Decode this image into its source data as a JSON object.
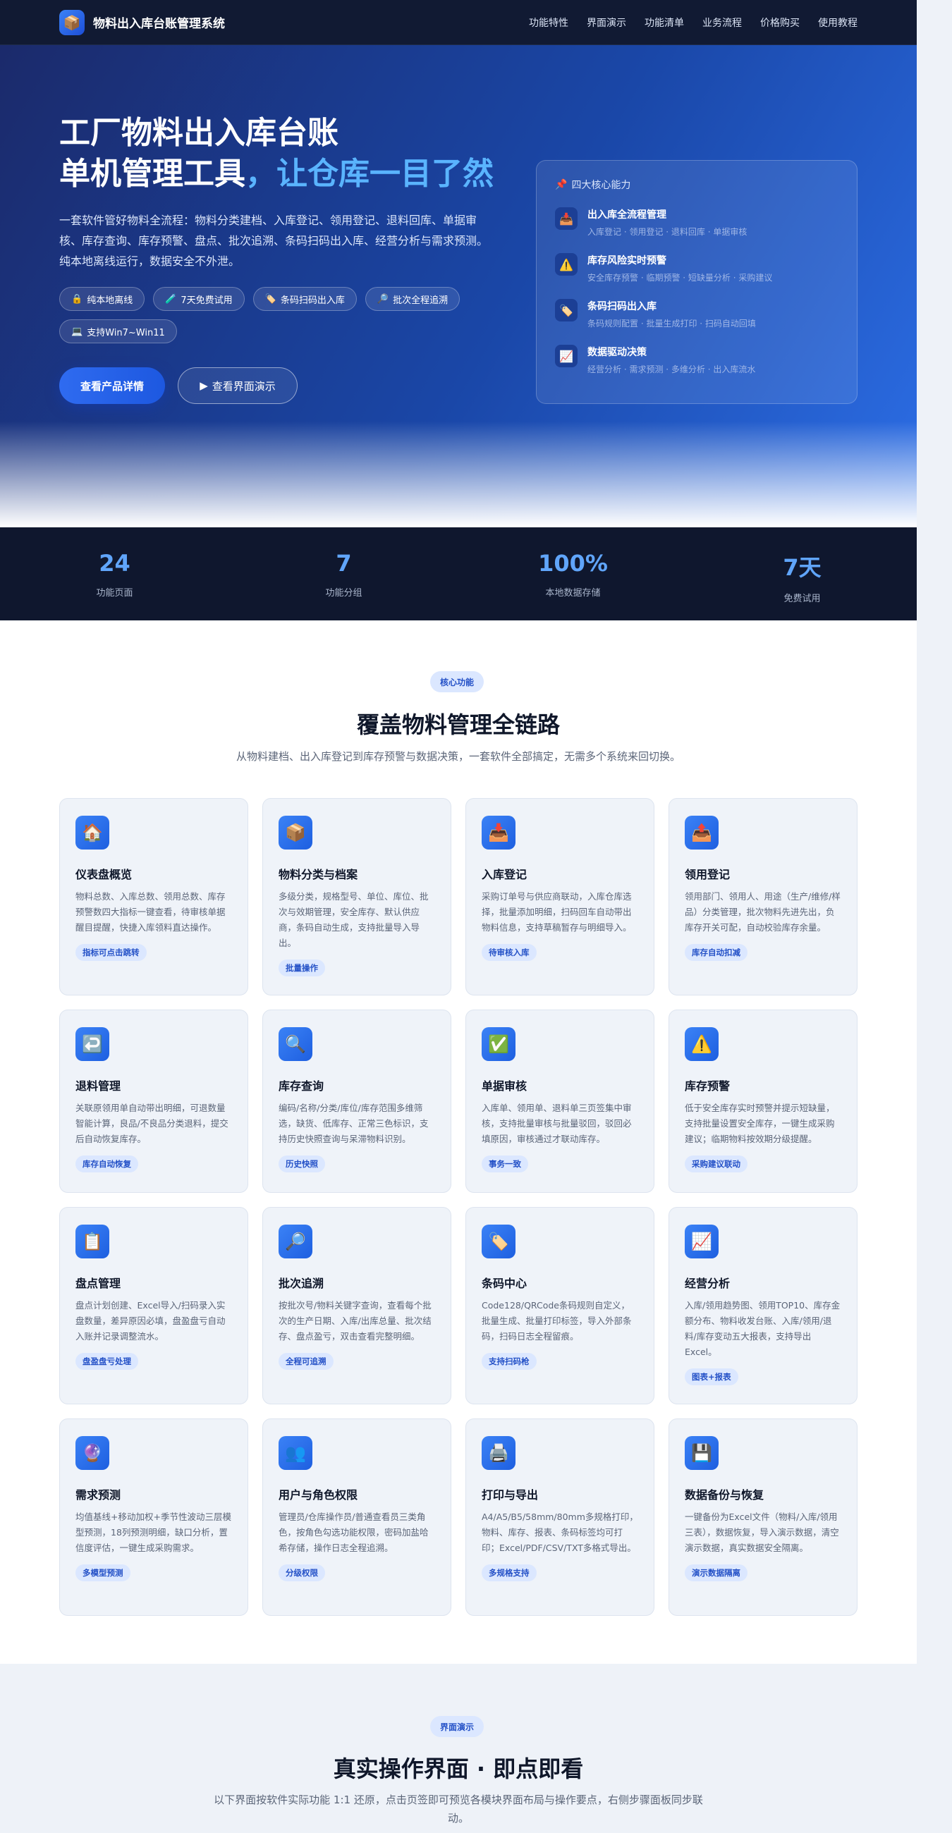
{
  "nav": {
    "brand_icon": "box-icon",
    "brand": "物料出入库台账管理系统",
    "links": [
      "功能特性",
      "界面演示",
      "功能清单",
      "业务流程",
      "价格购买",
      "使用教程"
    ]
  },
  "hero": {
    "title_line1": "工厂物料出入库台账",
    "title_line2": "单机管理工具",
    "title_accent": "，让仓库一目了然",
    "description": "一套软件管好物料全流程：物料分类建档、入库登记、领用登记、退料回库、单据审核、库存查询、库存预警、盘点、批次追溯、条码扫码出入库、经营分析与需求预测。纯本地离线运行，数据安全不外泄。",
    "chips": [
      {
        "icon": "🔒",
        "label": "纯本地离线"
      },
      {
        "icon": "🧪",
        "label": "7天免费试用"
      },
      {
        "icon": "🏷️",
        "label": "条码扫码出入库"
      },
      {
        "icon": "🔎",
        "label": "批次全程追溯"
      },
      {
        "icon": "💻",
        "label": "支持Win7~Win11"
      }
    ],
    "primary_button": "查看产品详情",
    "secondary_button": "查看界面演示"
  },
  "capabilities": {
    "header": "四大核心能力",
    "items": [
      {
        "icon": "📥",
        "title": "出入库全流程管理",
        "sub": "入库登记 · 领用登记 · 退料回库 · 单据审核"
      },
      {
        "icon": "⚠️",
        "title": "库存风险实时预警",
        "sub": "安全库存预警 · 临期预警 · 短缺量分析 · 采购建议"
      },
      {
        "icon": "🏷️",
        "title": "条码扫码出入库",
        "sub": "条码规则配置 · 批量生成打印 · 扫码自动回填"
      },
      {
        "icon": "📈",
        "title": "数据驱动决策",
        "sub": "经营分析 · 需求预测 · 多维分析 · 出入库流水"
      }
    ]
  },
  "stats": [
    {
      "value": "24",
      "label": "功能页面"
    },
    {
      "value": "7",
      "label": "功能分组"
    },
    {
      "value": "100%",
      "label": "本地数据存储"
    },
    {
      "value": "7天",
      "label": "免费试用"
    }
  ],
  "features": {
    "tag": "核心功能",
    "title": "覆盖物料管理全链路",
    "subtitle": "从物料建档、出入库登记到库存预警与数据决策，一套软件全部搞定，无需多个系统来回切换。",
    "cards": [
      {
        "icon": "🏠",
        "title": "仪表盘概览",
        "desc": "物料总数、入库总数、领用总数、库存预警数四大指标一键查看，待审核单据醒目提醒，快捷入库领料直达操作。",
        "tag": "指标可点击跳转"
      },
      {
        "icon": "📦",
        "title": "物料分类与档案",
        "desc": "多级分类，规格型号、单位、库位、批次与效期管理，安全库存、默认供应商，条码自动生成，支持批量导入导出。",
        "tag": "批量操作"
      },
      {
        "icon": "📥",
        "title": "入库登记",
        "desc": "采购订单号与供应商联动，入库仓库选择，批量添加明细，扫码回车自动带出物料信息，支持草稿暂存与明细导入。",
        "tag": "待审核入库"
      },
      {
        "icon": "📤",
        "title": "领用登记",
        "desc": "领用部门、领用人、用途（生产/维修/样品）分类管理，批次物料先进先出，负库存开关可配，自动校验库存余量。",
        "tag": "库存自动扣减"
      },
      {
        "icon": "↩️",
        "title": "退料管理",
        "desc": "关联原领用单自动带出明细，可退数量智能计算，良品/不良品分类退料，提交后自动恢复库存。",
        "tag": "库存自动恢复"
      },
      {
        "icon": "🔍",
        "title": "库存查询",
        "desc": "编码/名称/分类/库位/库存范围多维筛选，缺货、低库存、正常三色标识，支持历史快照查询与呆滞物料识别。",
        "tag": "历史快照"
      },
      {
        "icon": "✅",
        "title": "单据审核",
        "desc": "入库单、领用单、退料单三页签集中审核，支持批量审核与批量驳回，驳回必填原因，审核通过才联动库存。",
        "tag": "事务一致"
      },
      {
        "icon": "⚠️",
        "title": "库存预警",
        "desc": "低于安全库存实时预警并提示短缺量，支持批量设置安全库存，一键生成采购建议；临期物料按效期分级提醒。",
        "tag": "采购建议联动"
      },
      {
        "icon": "📋",
        "title": "盘点管理",
        "desc": "盘点计划创建、Excel导入/扫码录入实盘数量，差异原因必填，盘盈盘亏自动入账并记录调整流水。",
        "tag": "盘盈盘亏处理"
      },
      {
        "icon": "🔎",
        "title": "批次追溯",
        "desc": "按批次号/物料关键字查询，查看每个批次的生产日期、入库/出库总量、批次结存、盘点盈亏，双击查看完整明细。",
        "tag": "全程可追溯"
      },
      {
        "icon": "🏷️",
        "title": "条码中心",
        "desc": "Code128/QRCode条码规则自定义，批量生成、批量打印标签，导入外部条码，扫码日志全程留痕。",
        "tag": "支持扫码枪"
      },
      {
        "icon": "📈",
        "title": "经营分析",
        "desc": "入库/领用趋势图、领用TOP10、库存金额分布、物料收发台账、入库/领用/退料/库存变动五大报表，支持导出Excel。",
        "tag": "图表+报表"
      },
      {
        "icon": "🔮",
        "title": "需求预测",
        "desc": "均值基线+移动加权+季节性波动三层模型预测，18列预测明细，缺口分析，置信度评估，一键生成采购需求。",
        "tag": "多模型预测"
      },
      {
        "icon": "👥",
        "title": "用户与角色权限",
        "desc": "管理员/仓库操作员/普通查看员三类角色，按角色勾选功能权限，密码加盐哈希存储，操作日志全程追溯。",
        "tag": "分级权限"
      },
      {
        "icon": "🖨️",
        "title": "打印与导出",
        "desc": "A4/A5/B5/58mm/80mm多规格打印，物料、库存、报表、条码标签均可打印；Excel/PDF/CSV/TXT多格式导出。",
        "tag": "多规格支持"
      },
      {
        "icon": "💾",
        "title": "数据备份与恢复",
        "desc": "一键备份为Excel文件（物料/入库/领用三表），数据恢复，导入演示数据，清空演示数据，真实数据安全隔离。",
        "tag": "演示数据隔离"
      }
    ]
  },
  "demo": {
    "tag": "界面演示",
    "title": "真实操作界面 · 即点即看",
    "subtitle": "以下界面按软件实际功能 1:1 还原，点击页签即可预览各模块界面布局与操作要点，右侧步骤面板同步联动。"
  }
}
